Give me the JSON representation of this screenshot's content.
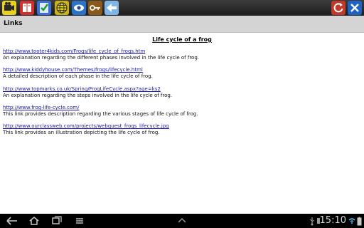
{
  "toolbar": {
    "left_icons": [
      "video-camera-icon",
      "book-icon",
      "checklist-icon",
      "globe-icon",
      "eye-icon",
      "key-icon",
      "back-arrow-icon"
    ],
    "right_icons": [
      "refresh-icon",
      "close-icon"
    ]
  },
  "titlebar": {
    "title": "Links"
  },
  "page": {
    "heading": "Life cycle of a frog",
    "links": [
      {
        "url": "http://www.tooter4kids.com/Frogs/life_cycle_of_frogs.htm",
        "description": "An explanation regarding the different phases involved in the life cycle of frog."
      },
      {
        "url": "http://www.kiddyhouse.com/Themes/frogs/lifecycle.html",
        "description": "A detailed description of each phase in the life cycle of frog."
      },
      {
        "url": "http://www.topmarks.co.uk/Spring/FrogLifeCycle.aspx?age=ks2",
        "description": "An explanation regarding the steps involved in the life cycle of frog."
      },
      {
        "url": "http://www.frog-life-cycle.com/",
        "description": "This link provides description regarding the various stages of life cycle of frog."
      },
      {
        "url": "http://www.ourclassweb.com/projects/webquest_frogs_lifecycle.jpg",
        "description": "This link provides an illustration depicting the life cycle of frog."
      }
    ]
  },
  "statusbar": {
    "time": "15:10",
    "nav_icons": [
      "back-icon",
      "home-icon",
      "recent-apps-icon",
      "up-chevron-icon",
      "usb-icon",
      "notification-icon",
      "wifi-icon",
      "battery-icon"
    ]
  },
  "colors": {
    "toolbar_bg": "#2b2b2b",
    "titlebar_bg": "#d4d4d4",
    "link": "#1a1aa8",
    "navbar_bg": "#000000"
  }
}
